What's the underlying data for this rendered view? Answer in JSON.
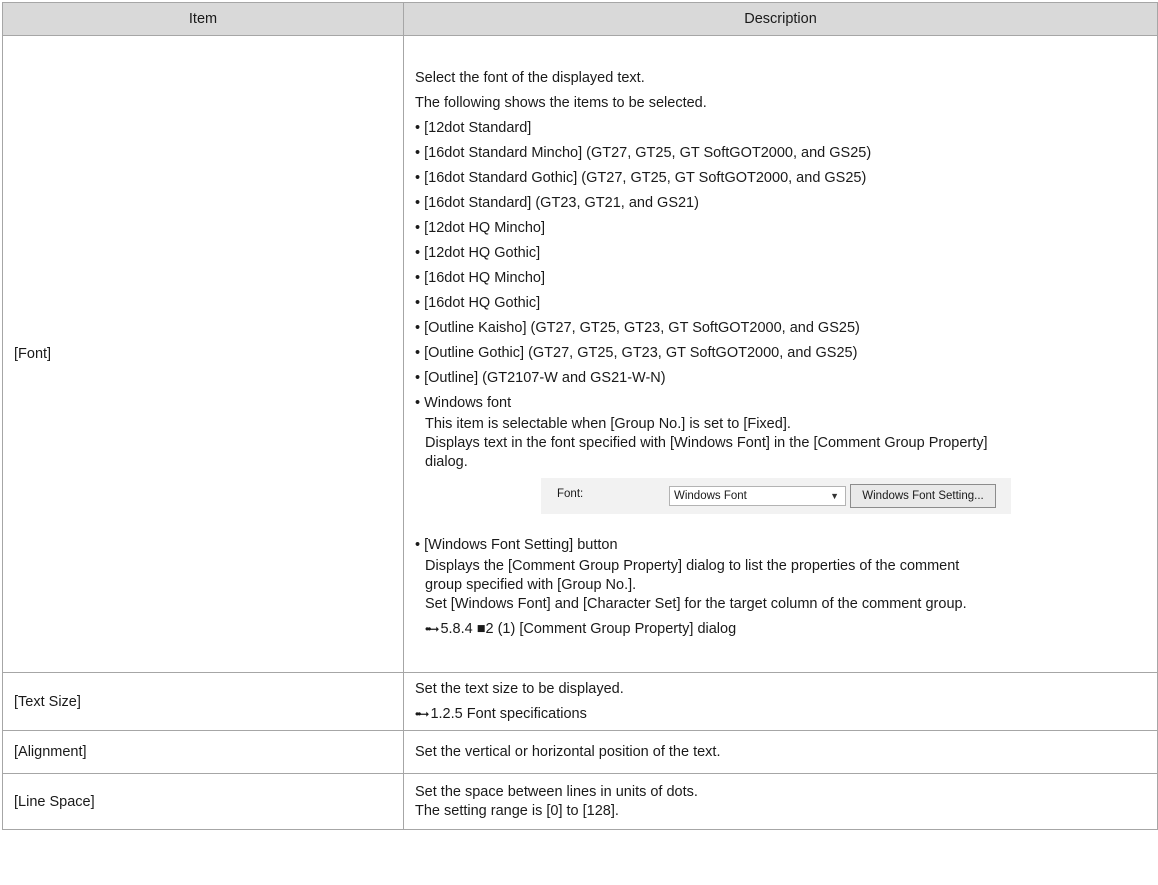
{
  "table": {
    "header": {
      "item": "Item",
      "description": "Description"
    },
    "rows": [
      {
        "item": "[Font]",
        "lines": [
          "Select the font of the displayed text.",
          "The following shows the items to be selected.",
          "• [12dot Standard]",
          "• [16dot Standard Mincho] (GT27, GT25, GT SoftGOT2000, and GS25)",
          "• [16dot Standard Gothic] (GT27, GT25, GT SoftGOT2000, and GS25)",
          "• [16dot Standard] (GT23, GT21, and GS21)",
          "• [12dot HQ Mincho]",
          "• [12dot HQ Gothic]",
          "• [16dot HQ Mincho]",
          "• [16dot HQ Gothic]",
          "• [Outline Kaisho] (GT27, GT25, GT23, GT SoftGOT2000, and GS25)",
          "• [Outline Gothic] (GT27, GT25, GT23, GT SoftGOT2000, and GS25)",
          "• [Outline] (GT2107-W and GS21-W-N)",
          "• Windows font"
        ],
        "windows_font_note": [
          "This item is selectable when [Group No.] is set to [Fixed].",
          "Displays text in the font specified with [Windows Font] in the [Comment Group Property]",
          "dialog."
        ],
        "widget": {
          "label": "Font:",
          "select_value": "Windows Font",
          "button_label": "Windows Font Setting..."
        },
        "button_heading": "• [Windows Font Setting] button",
        "button_note": [
          "Displays the [Comment Group Property] dialog to list the properties of the comment",
          "group specified with [Group No.].",
          "Set [Windows Font] and [Character Set] for the target column of the comment group."
        ],
        "reference": "5.8.4 ■2 (1) [Comment Group Property] dialog"
      },
      {
        "item": "[Text Size]",
        "lines": [
          "Set the text size to be displayed."
        ],
        "reference": "1.2.5 Font specifications"
      },
      {
        "item": "[Alignment]",
        "lines": [
          "Set the vertical or horizontal position of the text."
        ]
      },
      {
        "item": "[Line Space]",
        "lines": [
          "Set the space between lines in units of dots.",
          "The setting range is [0] to [128]."
        ]
      }
    ]
  }
}
